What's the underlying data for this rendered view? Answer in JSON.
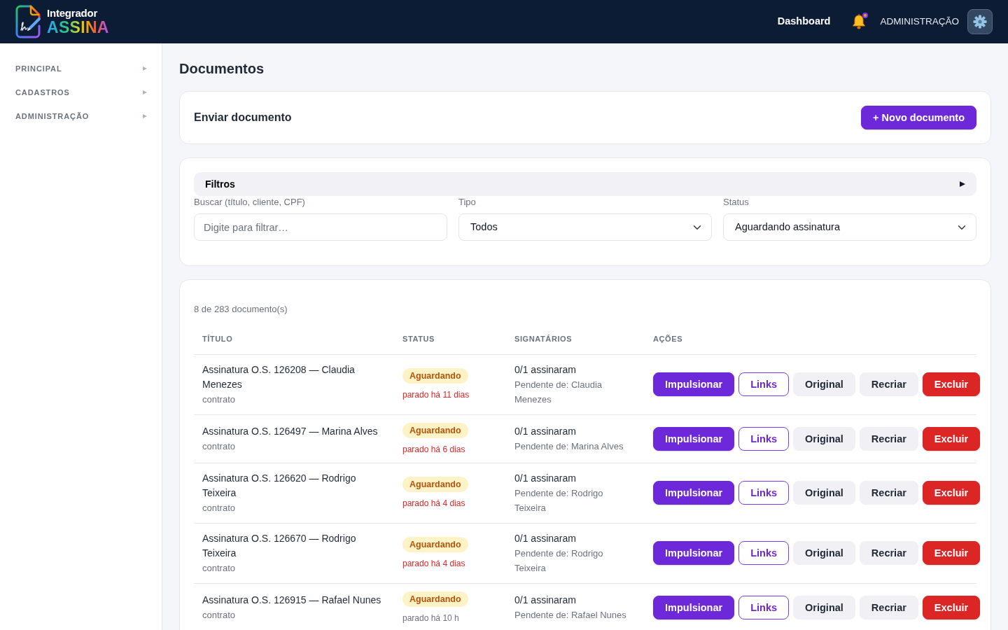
{
  "header": {
    "brand": {
      "line_1": "Integrador",
      "line_2": "ASSINA"
    },
    "nav_link": "Dashboard",
    "notification": {
      "unread": true
    },
    "admin_label": "ADMINISTRAÇÃO"
  },
  "sidebar": {
    "items": [
      {
        "label": "PRINCIPAL",
        "expanded": false
      },
      {
        "label": "CADASTROS",
        "expanded": false
      },
      {
        "label": "ADMINISTRAÇÃO",
        "expanded": false
      }
    ]
  },
  "page_title": "Documentos",
  "send_card": {
    "title": "Enviar documento",
    "button": "+ Novo documento"
  },
  "filters": {
    "title": "Filtros",
    "fields": [
      {
        "kind": "text",
        "label": "Buscar (título, cliente, CPF)",
        "placeholder": "Digite para filtrar…"
      },
      {
        "kind": "select",
        "label": "Tipo",
        "value": "Todos"
      },
      {
        "kind": "select",
        "label": "Status",
        "value": "Aguardando assinatura"
      }
    ]
  },
  "table": {
    "count": "8 de 283 documento(s)",
    "columns": [
      "TÍTULO",
      "STATUS",
      "SIGNATÁRIOS",
      "AÇÕES"
    ],
    "rows": [
      {
        "title": "Assinatura O.S. 126208 — Claudia Menezes",
        "type": "contrato",
        "status": "Aguardando",
        "idle": "parado há 11 dias",
        "alert": true,
        "signed": "0/1 assinaram",
        "pending": "Pendente de: Claudia Menezes",
        "actions": [
          {
            "label": "Impulsionar",
            "kind": "primary"
          },
          {
            "label": "Links",
            "kind": "outline"
          },
          {
            "label": "Original",
            "kind": "light"
          },
          {
            "label": "Recriar",
            "kind": "light"
          },
          {
            "label": "Excluir",
            "kind": "danger"
          }
        ]
      },
      {
        "title": "Assinatura O.S. 126497 — Marina Alves",
        "type": "contrato",
        "status": "Aguardando",
        "idle": "parado há 6 dias",
        "alert": true,
        "signed": "0/1 assinaram",
        "pending": "Pendente de: Marina Alves",
        "actions": [
          {
            "label": "Impulsionar",
            "kind": "primary"
          },
          {
            "label": "Links",
            "kind": "outline"
          },
          {
            "label": "Original",
            "kind": "light"
          },
          {
            "label": "Recriar",
            "kind": "light"
          },
          {
            "label": "Excluir",
            "kind": "danger"
          }
        ]
      },
      {
        "title": "Assinatura O.S. 126620 — Rodrigo Teixeira",
        "type": "contrato",
        "status": "Aguardando",
        "idle": "parado há 4 dias",
        "alert": true,
        "signed": "0/1 assinaram",
        "pending": "Pendente de: Rodrigo Teixeira",
        "actions": [
          {
            "label": "Impulsionar",
            "kind": "primary"
          },
          {
            "label": "Links",
            "kind": "outline"
          },
          {
            "label": "Original",
            "kind": "light"
          },
          {
            "label": "Recriar",
            "kind": "light"
          },
          {
            "label": "Excluir",
            "kind": "danger"
          }
        ]
      },
      {
        "title": "Assinatura O.S. 126670 — Rodrigo Teixeira",
        "type": "contrato",
        "status": "Aguardando",
        "idle": "parado há 4 dias",
        "alert": true,
        "signed": "0/1 assinaram",
        "pending": "Pendente de: Rodrigo Teixeira",
        "actions": [
          {
            "label": "Impulsionar",
            "kind": "primary"
          },
          {
            "label": "Links",
            "kind": "outline"
          },
          {
            "label": "Original",
            "kind": "light"
          },
          {
            "label": "Recriar",
            "kind": "light"
          },
          {
            "label": "Excluir",
            "kind": "danger"
          }
        ]
      },
      {
        "title": "Assinatura O.S. 126915 — Rafael Nunes",
        "type": "contrato",
        "status": "Aguardando",
        "idle": "parado há 10 h",
        "alert": false,
        "signed": "0/1 assinaram",
        "pending": "Pendente de: Rafael Nunes",
        "actions": [
          {
            "label": "Impulsionar",
            "kind": "primary"
          },
          {
            "label": "Links",
            "kind": "outline"
          },
          {
            "label": "Original",
            "kind": "light"
          },
          {
            "label": "Recriar",
            "kind": "light"
          },
          {
            "label": "Excluir",
            "kind": "danger"
          }
        ]
      }
    ]
  }
}
